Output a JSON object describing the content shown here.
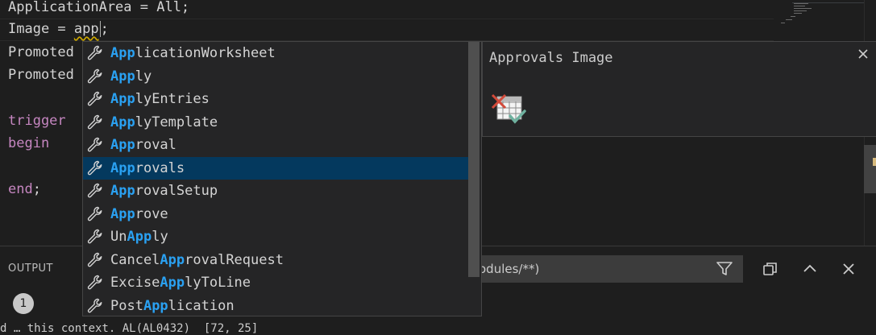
{
  "editor": {
    "lines": [
      {
        "text": "ApplicationArea = All;"
      },
      {
        "prefix": "Image = ",
        "typed": "app",
        "suffix": ";"
      },
      {
        "text": "Promoted"
      },
      {
        "text": "Promoted"
      },
      {
        "text": ""
      },
      {
        "keyword": "trigger"
      },
      {
        "keyword": "begin"
      },
      {
        "text": ""
      },
      {
        "keyword": "end",
        "suffix": ";"
      }
    ]
  },
  "suggest": {
    "items": [
      {
        "pre": "",
        "match": "App",
        "post": "licationWorksheet",
        "icon": "wrench-icon"
      },
      {
        "pre": "",
        "match": "App",
        "post": "ly",
        "icon": "wrench-icon"
      },
      {
        "pre": "",
        "match": "App",
        "post": "lyEntries",
        "icon": "wrench-icon"
      },
      {
        "pre": "",
        "match": "App",
        "post": "lyTemplate",
        "icon": "wrench-icon"
      },
      {
        "pre": "",
        "match": "App",
        "post": "roval",
        "icon": "wrench-icon"
      },
      {
        "pre": "",
        "match": "App",
        "post": "rovals",
        "icon": "wrench-icon",
        "selected": true
      },
      {
        "pre": "",
        "match": "App",
        "post": "rovalSetup",
        "icon": "wrench-icon"
      },
      {
        "pre": "",
        "match": "App",
        "post": "rove",
        "icon": "wrench-icon"
      },
      {
        "pre": "Un",
        "match": "App",
        "post": "ly",
        "icon": "wrench-icon"
      },
      {
        "pre": "Cancel",
        "match": "App",
        "post": "rovalRequest",
        "icon": "wrench-icon"
      },
      {
        "pre": "Excise",
        "match": "App",
        "post": "lyToLine",
        "icon": "wrench-icon"
      },
      {
        "pre": "Post",
        "match": "App",
        "post": "lication",
        "icon": "wrench-icon"
      }
    ]
  },
  "details": {
    "title": "Approvals Image",
    "image_icon": "approvals-image-icon"
  },
  "panel": {
    "title": "OUTPUT",
    "filter_text": "odules/**)",
    "badge": "1",
    "bottom_text": "d … this context. AL(AL0432)  [72, 25]"
  },
  "colors": {
    "keyword": "#c586c0",
    "match_highlight": "#2aa1f2",
    "selection": "#04395e",
    "background": "#1e1e1e"
  }
}
